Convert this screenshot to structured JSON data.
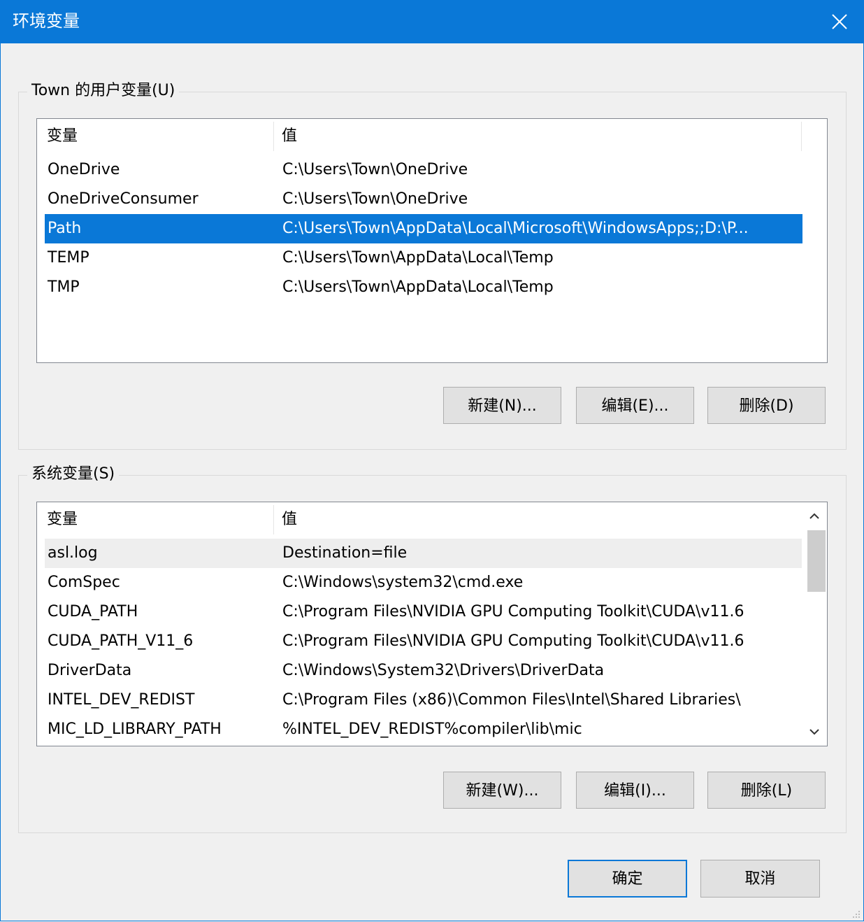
{
  "window": {
    "title": "环境变量",
    "close_icon": "close-icon"
  },
  "colors": {
    "titlebar": "#0a78d7",
    "selection": "#0a78d7",
    "background": "#f0f0f0"
  },
  "user_vars": {
    "group_label": "Town 的用户变量(U)",
    "header": {
      "name": "变量",
      "value": "值"
    },
    "rows": [
      {
        "name": "OneDrive",
        "value": "C:\\Users\\Town\\OneDrive"
      },
      {
        "name": "OneDriveConsumer",
        "value": "C:\\Users\\Town\\OneDrive"
      },
      {
        "name": "Path",
        "value": "C:\\Users\\Town\\AppData\\Local\\Microsoft\\WindowsApps;;D:\\P..."
      },
      {
        "name": "TEMP",
        "value": "C:\\Users\\Town\\AppData\\Local\\Temp"
      },
      {
        "name": "TMP",
        "value": "C:\\Users\\Town\\AppData\\Local\\Temp"
      }
    ],
    "selected_row": "Path",
    "buttons": {
      "new": "新建(N)...",
      "edit": "编辑(E)...",
      "delete": "删除(D)"
    }
  },
  "system_vars": {
    "group_label": "系统变量(S)",
    "header": {
      "name": "变量",
      "value": "值"
    },
    "rows": [
      {
        "name": "asl.log",
        "value": "Destination=file"
      },
      {
        "name": "ComSpec",
        "value": "C:\\Windows\\system32\\cmd.exe"
      },
      {
        "name": "CUDA_PATH",
        "value": "C:\\Program Files\\NVIDIA GPU Computing Toolkit\\CUDA\\v11.6"
      },
      {
        "name": "CUDA_PATH_V11_6",
        "value": "C:\\Program Files\\NVIDIA GPU Computing Toolkit\\CUDA\\v11.6"
      },
      {
        "name": "DriverData",
        "value": "C:\\Windows\\System32\\Drivers\\DriverData"
      },
      {
        "name": "INTEL_DEV_REDIST",
        "value": "C:\\Program Files (x86)\\Common Files\\Intel\\Shared Libraries\\"
      },
      {
        "name": "MIC_LD_LIBRARY_PATH",
        "value": "%INTEL_DEV_REDIST%compiler\\lib\\mic"
      }
    ],
    "highlighted_row": "asl.log",
    "scrollbar": {
      "up_icon": "chevron-up-icon",
      "down_icon": "chevron-down-icon"
    },
    "buttons": {
      "new": "新建(W)...",
      "edit": "编辑(I)...",
      "delete": "删除(L)"
    }
  },
  "dialog_buttons": {
    "ok": "确定",
    "cancel": "取消"
  }
}
